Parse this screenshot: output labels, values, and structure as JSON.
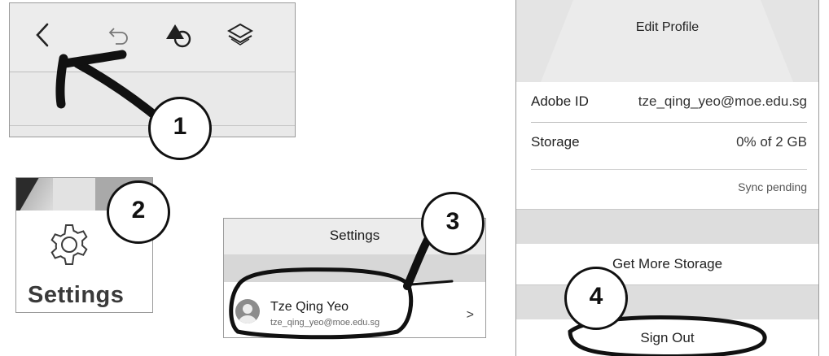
{
  "panel1": {
    "icons": [
      "back-chevron-icon",
      "undo-icon",
      "shape-shapes-icon",
      "layers-icon"
    ]
  },
  "panel2": {
    "label": "Settings",
    "icon": "gear-icon"
  },
  "panel3": {
    "header": "Settings",
    "user": {
      "name": "Tze Qing Yeo",
      "email": "tze_qing_yeo@moe.edu.sg"
    },
    "chevron": ">"
  },
  "panel4": {
    "edit_profile": "Edit Profile",
    "adobe_id_label": "Adobe ID",
    "adobe_id_value": "tze_qing_yeo@moe.edu.sg",
    "storage_label": "Storage",
    "storage_value": "0% of 2 GB",
    "sync_status": "Sync pending",
    "more_storage": "Get More Storage",
    "sign_out": "Sign Out"
  },
  "steps": [
    "1",
    "2",
    "3",
    "4"
  ],
  "colors": {
    "panel_gray": "#e9e9e9",
    "section_gap": "#dddddd",
    "annotation_ink": "#111111"
  }
}
